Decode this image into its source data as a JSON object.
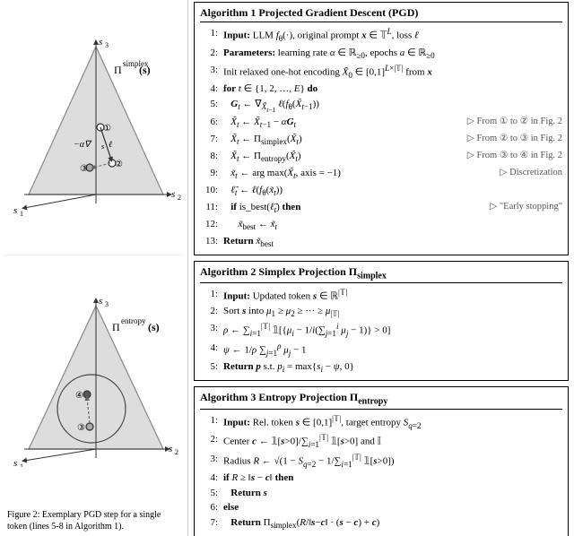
{
  "left": {
    "caption": "Figure 2:  Exemplary PGD step for a single token (lines 5-8 in Algorithm 1)."
  },
  "alg1": {
    "title": "Algorithm 1",
    "name": "Projected Gradient Descent (PGD)",
    "lines": [
      {
        "num": "1:",
        "content": "Input: LLM f_θ(·), original prompt x ∈ 𝕋^L, loss ℓ",
        "comment": ""
      },
      {
        "num": "2:",
        "content": "Parameters: learning rate α ∈ ℝ≥0, epochs a ∈ ℝ≥0",
        "comment": ""
      },
      {
        "num": "3:",
        "content": "Init relaxed one-hot encoding X̃₀ ∈ [0,1]^{L×|𝕋|} from x",
        "comment": ""
      },
      {
        "num": "4:",
        "content": "for t ∈ {1, 2, …, E} do",
        "comment": ""
      },
      {
        "num": "5:",
        "content": "  G_t ← ∇_{X̃_{t-1}} ℓ(f_θ(X̃_{t-1}))",
        "comment": ""
      },
      {
        "num": "6:",
        "content": "  X̃_t ← X̃_{t-1} − αG_t",
        "comment": "▷ From ① to ② in Fig. 2"
      },
      {
        "num": "7:",
        "content": "  X̃_t ← Π_simplex(X̃_t)",
        "comment": "▷ From ② to ③ in Fig. 2"
      },
      {
        "num": "8:",
        "content": "  X̃_t ← Π_entropy(X̃_t)",
        "comment": "▷ From ③ to ④ in Fig. 2"
      },
      {
        "num": "9:",
        "content": "  x̃_t ← arg max(X̃_t, axis = −1)",
        "comment": "▷ Discretization"
      },
      {
        "num": "10:",
        "content": "  ℓ̃_t ← ℓ(f_θ(x̃_t))",
        "comment": ""
      },
      {
        "num": "11:",
        "content": "  if is_best(ℓ̃_t) then",
        "comment": "▷ \"Early stopping\""
      },
      {
        "num": "12:",
        "content": "    x̃_best ← x̃_t",
        "comment": ""
      },
      {
        "num": "13:",
        "content": "Return x̃_best",
        "comment": ""
      }
    ]
  },
  "alg2": {
    "title": "Algorithm 2",
    "name": "Simplex Projection Π_simplex",
    "lines": [
      {
        "num": "1:",
        "content": "Input: Updated token s ∈ ℝ^{|𝕋|}",
        "comment": ""
      },
      {
        "num": "2:",
        "content": "Sort s into μ₁ ≥ μ₂ ≥ ··· ≥ μ_{|𝕋|}",
        "comment": ""
      },
      {
        "num": "3:",
        "content": "ρ ← ∑ᵢ₌₁^{|𝕋|} 𝟙[{μᵢ − 1/i(∑ⱼ₌₁ⁱ μⱼ − 1)} > 0]",
        "comment": ""
      },
      {
        "num": "4:",
        "content": "ψ ← 1/ρ ∑ⱼ₌₁^ρ μⱼ − 1",
        "comment": ""
      },
      {
        "num": "5:",
        "content": "Return p s.t. pᵢ = max{sᵢ − ψ, 0}",
        "comment": ""
      }
    ]
  },
  "alg3": {
    "title": "Algorithm 3",
    "name": "Entropy Projection Π_entropy",
    "lines": [
      {
        "num": "1:",
        "content": "Input: Rel. token s ∈ [0,1]^{|𝕋|}, target entropy S_{q=2}",
        "comment": ""
      },
      {
        "num": "2:",
        "content": "Center c ← 𝟙[s>0] / ∑ᵢ₌₁^{|𝕋|} 𝟙[s>0] and 𝕀",
        "comment": ""
      },
      {
        "num": "3:",
        "content": "Radius R ← √(1 − S_{q=2} − 1/∑_{i=1}^{|𝕋|} 𝟙[s>0])",
        "comment": ""
      },
      {
        "num": "4:",
        "content": "if R ≥ ‖s − c‖ then",
        "comment": ""
      },
      {
        "num": "5:",
        "content": "  Return s",
        "comment": ""
      },
      {
        "num": "6:",
        "content": "else",
        "comment": ""
      },
      {
        "num": "7:",
        "content": "  Return Π_simplex(R/‖s−c‖ · (s − c) + c)",
        "comment": ""
      }
    ]
  }
}
